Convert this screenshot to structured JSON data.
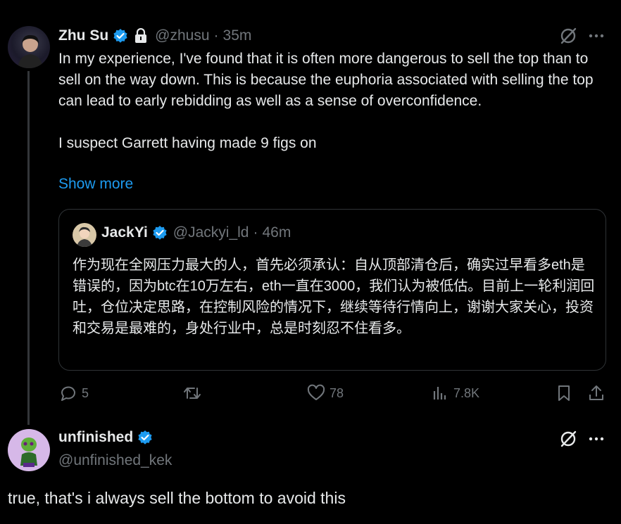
{
  "tweet": {
    "author_name": "Zhu Su",
    "handle": "@zhusu",
    "sep": "·",
    "time": "35m",
    "text": "In my experience, I've found that it is often more dangerous to sell the top than to sell on the way down. This is because the euphoria associated with selling the top can lead to early rebidding as well as a sense of overconfidence.\n\nI suspect Garrett having made 9 figs on",
    "show_more": "Show more",
    "quote": {
      "author_name": "JackYi",
      "handle": "@Jackyi_ld",
      "sep": "·",
      "time": "46m",
      "text": "作为现在全网压力最大的人，首先必须承认：自从顶部清仓后，确实过早看多eth是错误的，因为btc在10万左右，eth一直在3000，我们认为被低估。目前上一轮利润回吐，仓位决定思路，在控制风险的情况下，继续等待行情向上，谢谢大家关心，投资和交易是最难的，身处行业中，总是时刻忍不住看多。"
    },
    "actions": {
      "replies": "5",
      "likes": "78",
      "views": "7.8K"
    }
  },
  "reply": {
    "author_name": "unfinished",
    "handle": "@unfinished_kek",
    "text": "true, that's i always sell the bottom to avoid this"
  },
  "colors": {
    "background": "#000000",
    "text": "#e7e9ea",
    "muted": "#71767b",
    "link": "#1d9bf0",
    "verified": "#1d9bf0",
    "border": "#2f3336"
  },
  "icons": [
    "verified-badge-icon",
    "lock-icon",
    "grok-icon",
    "more-icon",
    "reply-icon",
    "retweet-icon",
    "like-icon",
    "views-icon",
    "bookmark-icon",
    "share-icon"
  ]
}
